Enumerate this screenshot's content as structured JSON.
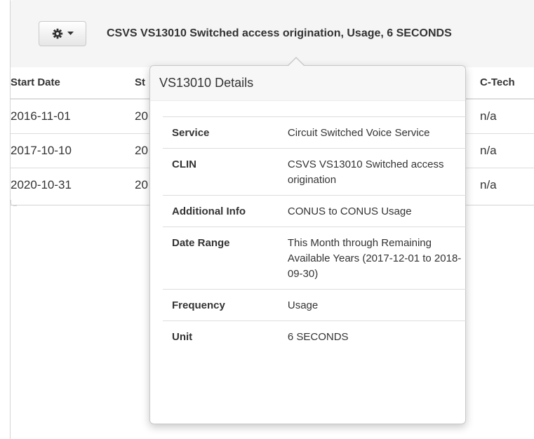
{
  "header": {
    "gear_icon": "gear-icon",
    "caret_icon": "caret-down-icon",
    "title": "CSVS VS13010 Switched access origination, Usage, 6 SECONDS"
  },
  "table": {
    "columns": [
      "Start Date",
      "St",
      "C-Tech"
    ],
    "rows": [
      {
        "start": "2016-11-01",
        "st": "20",
        "ctech": "n/a"
      },
      {
        "start": "2017-10-10",
        "st": "20",
        "ctech": "n/a"
      },
      {
        "start": "2020-10-31",
        "st": "20",
        "ctech": "n/a"
      }
    ]
  },
  "popover": {
    "title": "VS13010 Details",
    "details": [
      {
        "label": "Service",
        "value": "Circuit Switched Voice Service"
      },
      {
        "label": "CLIN",
        "value": "CSVS VS13010 Switched access origination"
      },
      {
        "label": "Additional Info",
        "value": "CONUS to CONUS Usage"
      },
      {
        "label": "Date Range",
        "value": "This Month through Remaining Available Years (2017-12-01 to 2018-09-30)"
      },
      {
        "label": "Frequency",
        "value": "Usage"
      },
      {
        "label": "Unit",
        "value": "6 SECONDS"
      }
    ]
  }
}
